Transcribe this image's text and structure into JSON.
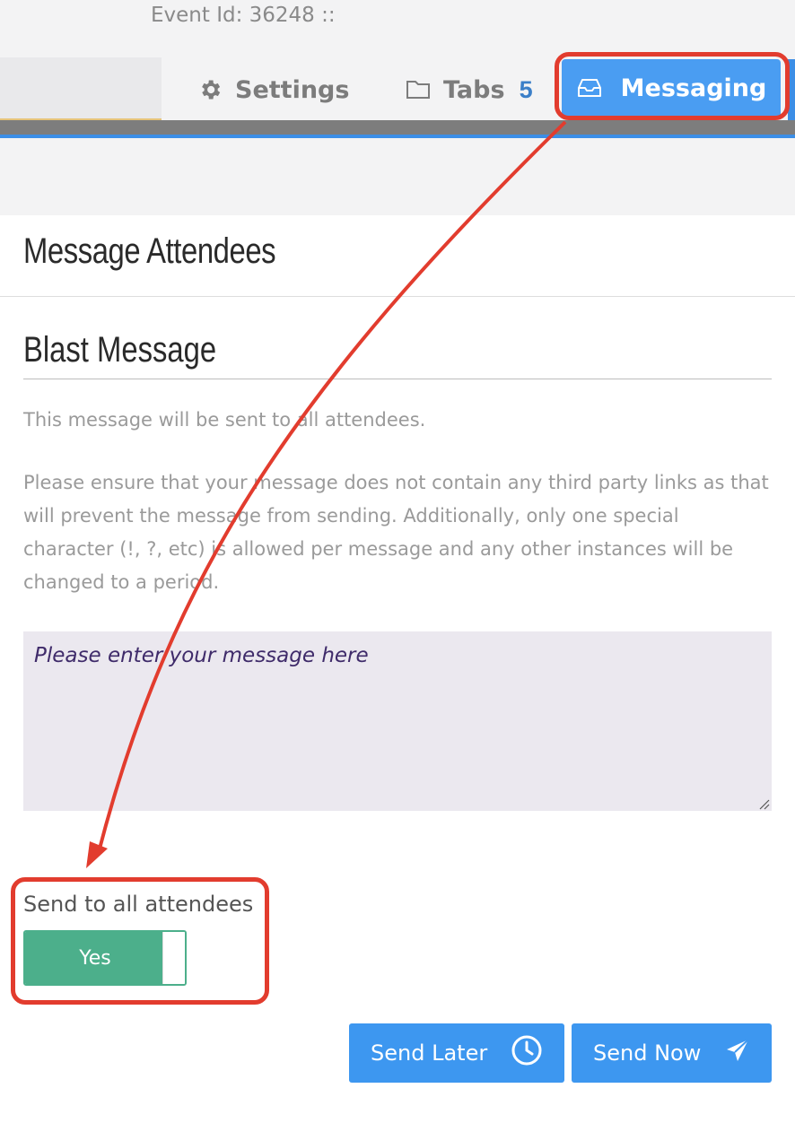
{
  "header": {
    "event_id": "Event Id: 36248 ::",
    "tabs": [
      {
        "label": "Settings",
        "icon": "gear-icon"
      },
      {
        "label": "Tabs",
        "icon": "folder-icon",
        "count": "5"
      },
      {
        "label": "Messaging",
        "icon": "inbox-icon",
        "active": true
      }
    ]
  },
  "panel": {
    "title": "Message Attendees",
    "section_title": "Blast Message",
    "intro": "This message will be sent to all attendees.",
    "warning": "Please ensure that your message does not contain any third party links as that will prevent the message from sending. Additionally, only one special character (!, ?, etc) is allowed per message and any other instances will be changed to a period.",
    "message_placeholder": "Please enter your message here",
    "send_all_label": "Send to all attendees",
    "send_all_value": "Yes"
  },
  "actions": {
    "send_later": "Send Later",
    "send_now": "Send Now"
  },
  "colors": {
    "accent": "#3d97f0",
    "toggle_on": "#4caf8b",
    "annotation": "#e23c2e"
  }
}
